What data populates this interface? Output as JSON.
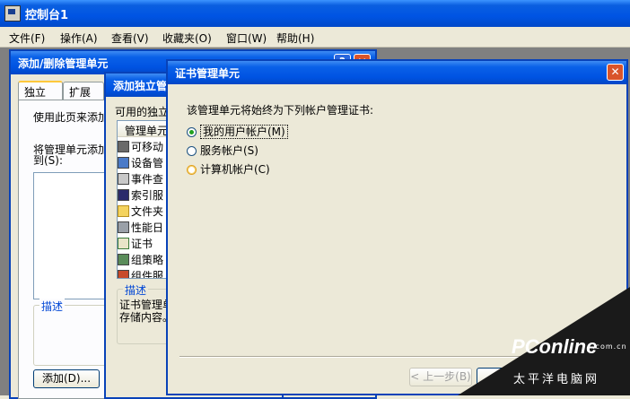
{
  "main_window": {
    "title": "控制台1",
    "menu": [
      "文件(F)",
      "操作(A)",
      "查看(V)",
      "收藏夹(O)",
      "窗口(W)",
      "帮助(H)"
    ]
  },
  "add_remove_dialog": {
    "title": "添加/删除管理单元",
    "tabs": [
      "独立",
      "扩展"
    ],
    "intro": "使用此页来添加",
    "snapins_label_1": "将管理单元添加",
    "snapins_label_2": "到(S):",
    "description_label": "描述",
    "add_button": "添加(D)..."
  },
  "add_standalone_dialog": {
    "title": "添加独立管",
    "available_label": "可用的独立",
    "column_header": "管理单元",
    "items": [
      {
        "label": "可移动",
        "icon": "removable-storage-icon"
      },
      {
        "label": "设备管",
        "icon": "device-manager-icon"
      },
      {
        "label": "事件查",
        "icon": "event-viewer-icon"
      },
      {
        "label": "索引服",
        "icon": "indexing-service-icon"
      },
      {
        "label": "文件夹",
        "icon": "folder-icon"
      },
      {
        "label": "性能日",
        "icon": "performance-logs-icon"
      },
      {
        "label": "证书",
        "icon": "certificates-icon"
      },
      {
        "label": "组策略",
        "icon": "group-policy-icon"
      },
      {
        "label": "组件服",
        "icon": "component-services-icon"
      }
    ],
    "description_label": "描述",
    "description_text_1": "证书管理单",
    "description_text_2": "存储内容。"
  },
  "cert_dialog": {
    "title": "证书管理单元",
    "prompt": "该管理单元将始终为下列帐户管理证书:",
    "options": [
      {
        "label": "我的用户帐户(M)",
        "selected": true
      },
      {
        "label": "服务帐户(S)",
        "selected": false
      },
      {
        "label": "计算机帐户(C)",
        "selected": false
      }
    ],
    "back_button": "< 上一步(B)",
    "finish_button": "完"
  },
  "watermark": {
    "logo": "PConline",
    "domain": ".com.cn",
    "cn": "太平洋电脑网"
  }
}
